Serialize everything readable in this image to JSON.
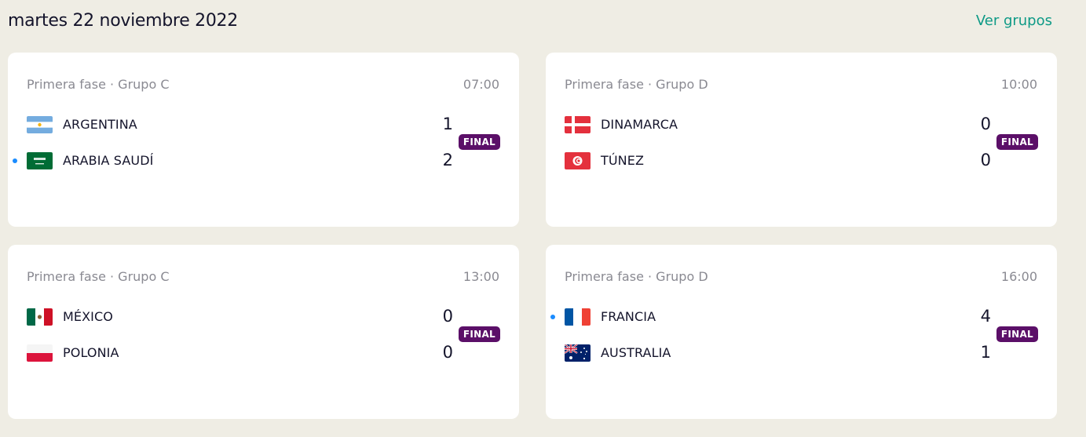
{
  "header": {
    "date": "martes 22 noviembre 2022",
    "groups_link": "Ver grupos"
  },
  "colors": {
    "background": "#efede4",
    "card": "#ffffff",
    "link": "#0e9a86",
    "badge": "#5b0f68",
    "winner_dot": "#1a8cff"
  },
  "matches": [
    {
      "phase": "Primera fase · Grupo C",
      "time": "07:00",
      "status": "FINAL",
      "home": {
        "name": "ARGENTINA",
        "flag": "argentina-flag-icon",
        "score": "1",
        "winner": false
      },
      "away": {
        "name": "ARABIA SAUDÍ",
        "flag": "saudi-arabia-flag-icon",
        "score": "2",
        "winner": true
      }
    },
    {
      "phase": "Primera fase · Grupo D",
      "time": "10:00",
      "status": "FINAL",
      "home": {
        "name": "DINAMARCA",
        "flag": "denmark-flag-icon",
        "score": "0",
        "winner": false
      },
      "away": {
        "name": "TÚNEZ",
        "flag": "tunisia-flag-icon",
        "score": "0",
        "winner": false
      }
    },
    {
      "phase": "Primera fase · Grupo C",
      "time": "13:00",
      "status": "FINAL",
      "home": {
        "name": "MÉXICO",
        "flag": "mexico-flag-icon",
        "score": "0",
        "winner": false
      },
      "away": {
        "name": "POLONIA",
        "flag": "poland-flag-icon",
        "score": "0",
        "winner": false
      }
    },
    {
      "phase": "Primera fase · Grupo D",
      "time": "16:00",
      "status": "FINAL",
      "home": {
        "name": "FRANCIA",
        "flag": "france-flag-icon",
        "score": "4",
        "winner": true
      },
      "away": {
        "name": "AUSTRALIA",
        "flag": "australia-flag-icon",
        "score": "1",
        "winner": false
      }
    }
  ]
}
